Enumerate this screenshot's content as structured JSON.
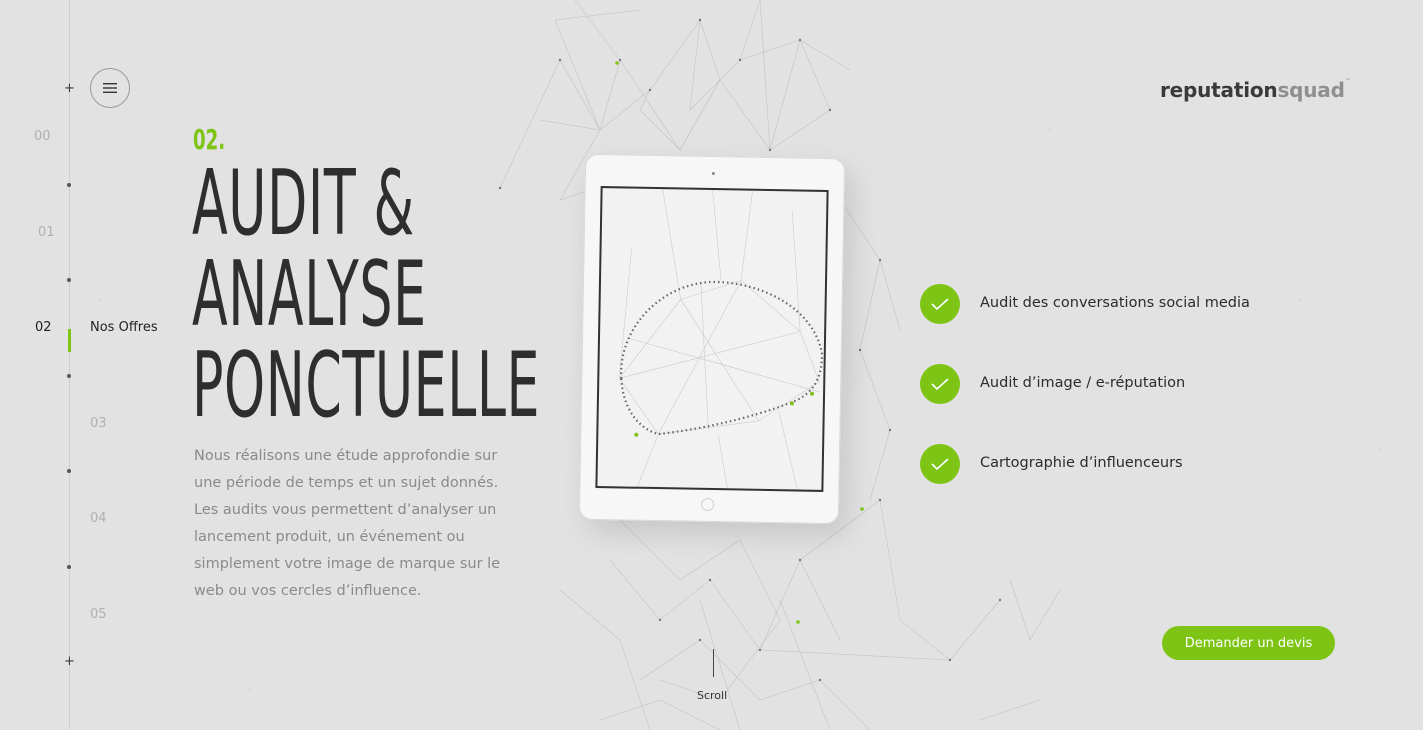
{
  "nav": {
    "items": [
      {
        "num": "00"
      },
      {
        "num": "01"
      },
      {
        "num": "02",
        "label": "Nos Offres"
      },
      {
        "num": "03"
      },
      {
        "num": "04"
      },
      {
        "num": "05"
      }
    ],
    "menu_icon": "hamburger-icon"
  },
  "header": {
    "logo_main": "reputation",
    "logo_accent": "squad",
    "logo_tm": "™"
  },
  "main": {
    "section_number": "02.",
    "title_lines": [
      "AUDIT &",
      "ANALYSE",
      "PONCTUELLE"
    ],
    "description": "Nous réalisons une étude approfondie sur une période de temps et un sujet donnés. Les audits vous permettent d’analyser un lancement produit, un événement ou simplement votre image de marque sur le web ou vos cercles d’influence."
  },
  "features": [
    {
      "label": "Audit des conversations social media",
      "icon": "check-icon"
    },
    {
      "label": "Audit d’image / e-réputation",
      "icon": "check-icon"
    },
    {
      "label": "Cartographie d’influenceurs",
      "icon": "check-icon"
    }
  ],
  "cta": {
    "label": "Demander un devis"
  },
  "scroll": {
    "label": "Scroll"
  },
  "colors": {
    "accent": "#7dc414",
    "background": "#e2e2e2",
    "text": "#2b2b2b",
    "muted": "#8a8a8a"
  }
}
